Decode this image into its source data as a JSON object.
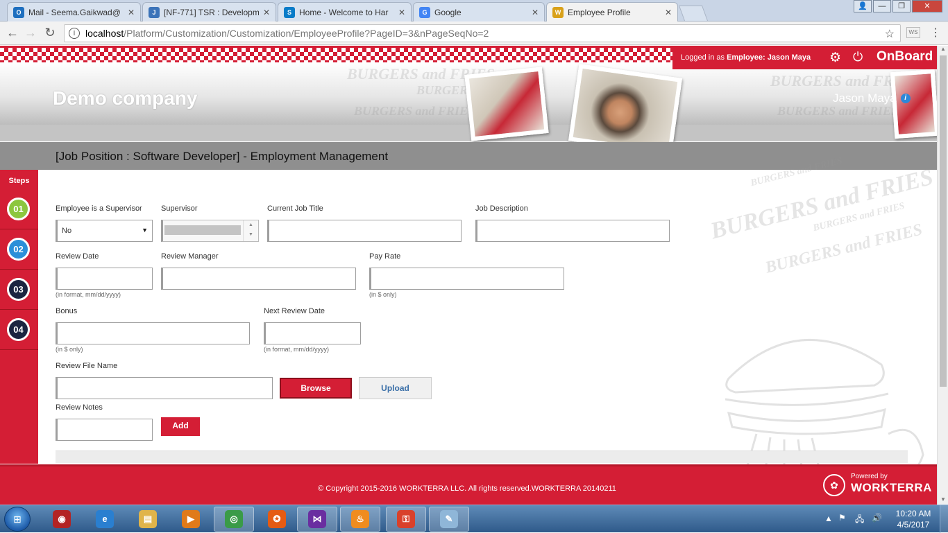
{
  "browser": {
    "tabs": [
      {
        "title": "Mail - Seema.Gaikwad@",
        "icon": "outlook-icon",
        "color": "#1e6fbf",
        "glyph": "O"
      },
      {
        "title": "[NF-771] TSR : Developm",
        "icon": "jira-icon",
        "color": "#3b73b9",
        "glyph": "J"
      },
      {
        "title": "Home - Welcome to Har",
        "icon": "sap-icon",
        "color": "#0a7cc8",
        "glyph": "S"
      },
      {
        "title": "Google",
        "icon": "google-icon",
        "color": "#4285f4",
        "glyph": "G"
      },
      {
        "title": "Employee Profile",
        "icon": "worker-icon",
        "color": "#d9a11a",
        "glyph": "W"
      }
    ],
    "url_host": "localhost",
    "url_path": "/Platform/Customization/Customization/EmployeeProfile?PageID=3&nPageSeqNo=2"
  },
  "header": {
    "login_prefix": "Logged in as",
    "login_role": "Employee:",
    "login_user": "Jason Maya",
    "brand": "OnBoard",
    "company": "Demo company",
    "user_name": "Jason Maya",
    "watermark": "BURGERS and FRIES"
  },
  "page_title": "[Job Position : Software Developer] - Employment Management",
  "steps": {
    "label": "Steps",
    "items": [
      {
        "num": "01",
        "color": "#8cc63f"
      },
      {
        "num": "02",
        "color": "#2b8fd8"
      },
      {
        "num": "03",
        "color": "#1b2440"
      },
      {
        "num": "04",
        "color": "#1b2440"
      }
    ]
  },
  "form": {
    "supervisor_flag_label": "Employee is a Supervisor",
    "supervisor_flag_value": "No",
    "supervisor_label": "Supervisor",
    "job_title_label": "Current Job Title",
    "job_desc_label": "Job Description",
    "review_date_label": "Review Date",
    "review_date_hint": "(in format, mm/dd/yyyy)",
    "review_manager_label": "Review Manager",
    "pay_rate_label": "Pay Rate",
    "pay_rate_hint": "(in $ only)",
    "bonus_label": "Bonus",
    "bonus_hint": "(in $ only)",
    "next_review_label": "Next Review Date",
    "next_review_hint": "(in format, mm/dd/yyyy)",
    "file_label": "Review File Name",
    "browse": "Browse",
    "upload": "Upload",
    "notes_label": "Review Notes",
    "add": "Add"
  },
  "footer": {
    "copyright": "© Copyright 2015-2016 WORKTERRA LLC. All rights reserved.WORKTERRA 20140211",
    "powered_by": "Powered by",
    "powered_brand": "WORKTERRA"
  },
  "taskbar": {
    "time": "10:20 AM",
    "date": "4/5/2017",
    "apps": [
      {
        "name": "media-center-icon",
        "color": "#b32424",
        "glyph": "◉"
      },
      {
        "name": "internet-explorer-icon",
        "color": "#2a7fd0",
        "glyph": "e"
      },
      {
        "name": "file-explorer-icon",
        "color": "#e0b44a",
        "glyph": "▤"
      },
      {
        "name": "media-player-icon",
        "color": "#e07a1a",
        "glyph": "▶"
      },
      {
        "name": "chrome-icon",
        "color": "#3a9b48",
        "glyph": "◎"
      },
      {
        "name": "firefox-icon",
        "color": "#e55b13",
        "glyph": "✪"
      },
      {
        "name": "visual-studio-icon",
        "color": "#6a2ea0",
        "glyph": "⋈"
      },
      {
        "name": "app-flame-icon",
        "color": "#f08c1e",
        "glyph": "♨"
      },
      {
        "name": "app-key-icon",
        "color": "#d9412b",
        "glyph": "⚿"
      },
      {
        "name": "app-notes-icon",
        "color": "#8fb6d8",
        "glyph": "✎"
      }
    ]
  }
}
